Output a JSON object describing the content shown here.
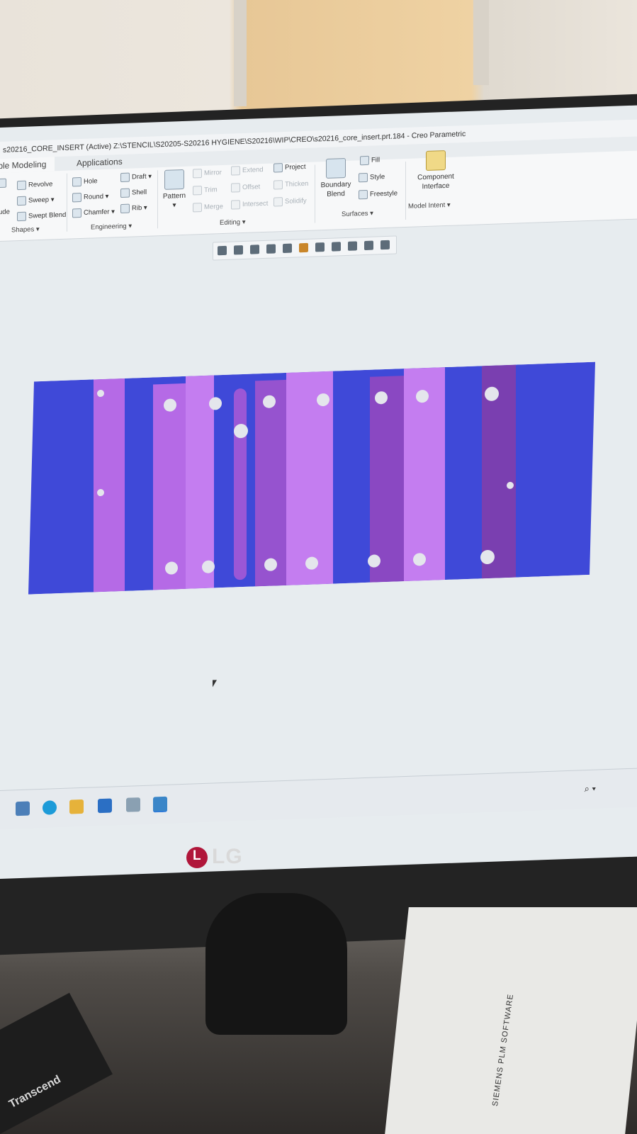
{
  "titlebar": {
    "title": "s20216_CORE_INSERT (Active) Z:\\STENCIL\\S20205-S20216 HYGIENE\\S20216\\WIP\\CREO\\s20216_core_insert.prt.184 - Creo Parametric"
  },
  "tabs": [
    {
      "label": "Flexible Modeling"
    },
    {
      "label": "Applications"
    }
  ],
  "ribbon": {
    "shapes": {
      "items": [
        "Revolve",
        "Sweep",
        "Swept Blend"
      ],
      "extra": "ude",
      "group": "Shapes"
    },
    "engineering": {
      "items": [
        "Hole",
        "Round",
        "Chamfer",
        "Draft",
        "Shell",
        "Rib"
      ],
      "group": "Engineering"
    },
    "editing": {
      "pattern": "Pattern",
      "items": [
        "Mirror",
        "Trim",
        "Merge",
        "Extend",
        "Offset",
        "Intersect",
        "Project",
        "Thicken",
        "Solidify"
      ],
      "group": "Editing"
    },
    "surfaces": {
      "boundary_blend": "Boundary Blend",
      "items": [
        "Fill",
        "Style",
        "Freestyle"
      ],
      "group": "Surfaces"
    },
    "model_intent": {
      "component_interface": "Component Interface",
      "group": "Model Intent"
    }
  },
  "view_toolbar": {
    "icons": [
      "refit-icon",
      "zoom-in-icon",
      "zoom-out-icon",
      "repaint-icon",
      "reorient-icon",
      "saved-views-icon",
      "display-style-icon",
      "view-manager-icon",
      "datum-display-icon",
      "annotation-display-icon",
      "spin-center-icon"
    ]
  },
  "model": {
    "colors": {
      "blue": "#3f49d8",
      "violet": "#b56ae6",
      "dark_violet": "#7a3fb0"
    }
  },
  "taskbar": {
    "icons": [
      "file-explorer-icon",
      "edge-icon",
      "folder-icon",
      "mail-icon",
      "network-icon",
      "creo-icon"
    ]
  },
  "brand": {
    "monitor": "LG",
    "drive": "Transcend",
    "paper": "SIEMENS PLM SOFTWARE"
  }
}
